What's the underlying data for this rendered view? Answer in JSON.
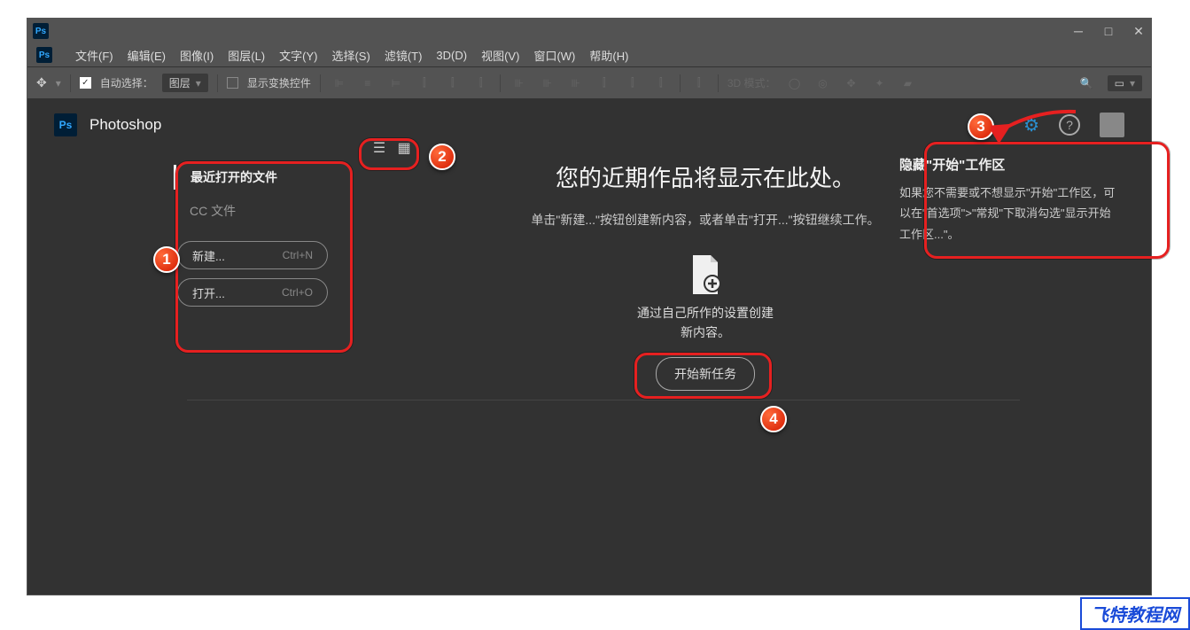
{
  "menubar": [
    "文件(F)",
    "编辑(E)",
    "图像(I)",
    "图层(L)",
    "文字(Y)",
    "选择(S)",
    "滤镜(T)",
    "3D(D)",
    "视图(V)",
    "窗口(W)",
    "帮助(H)"
  ],
  "toolbar": {
    "auto_select": "自动选择：",
    "layer_dropdown": "图层",
    "show_transform": "显示变换控件",
    "mode_3d": "3D 模式："
  },
  "home": {
    "app_name": "Photoshop",
    "recent_files": "最近打开的文件",
    "cc_files": "CC 文件",
    "new_btn": "新建...",
    "new_shortcut": "Ctrl+N",
    "open_btn": "打开...",
    "open_shortcut": "Ctrl+O"
  },
  "center": {
    "title": "您的近期作品将显示在此处。",
    "subtitle": "单击\"新建...\"按钮创建新内容，或者单击\"打开...\"按钮继续工作。",
    "desc1": "通过自己所作的设置创建",
    "desc2": "新内容。",
    "start": "开始新任务"
  },
  "info": {
    "title": "隐藏\"开始\"工作区",
    "text": "如果您不需要或不想显示\"开始\"工作区，可以在\"首选项\">\"常规\"下取消勾选\"显示开始工作区...\"。"
  },
  "anno": {
    "n1": "1",
    "n2": "2",
    "n3": "3",
    "n4": "4"
  },
  "watermark": "飞特教程网"
}
